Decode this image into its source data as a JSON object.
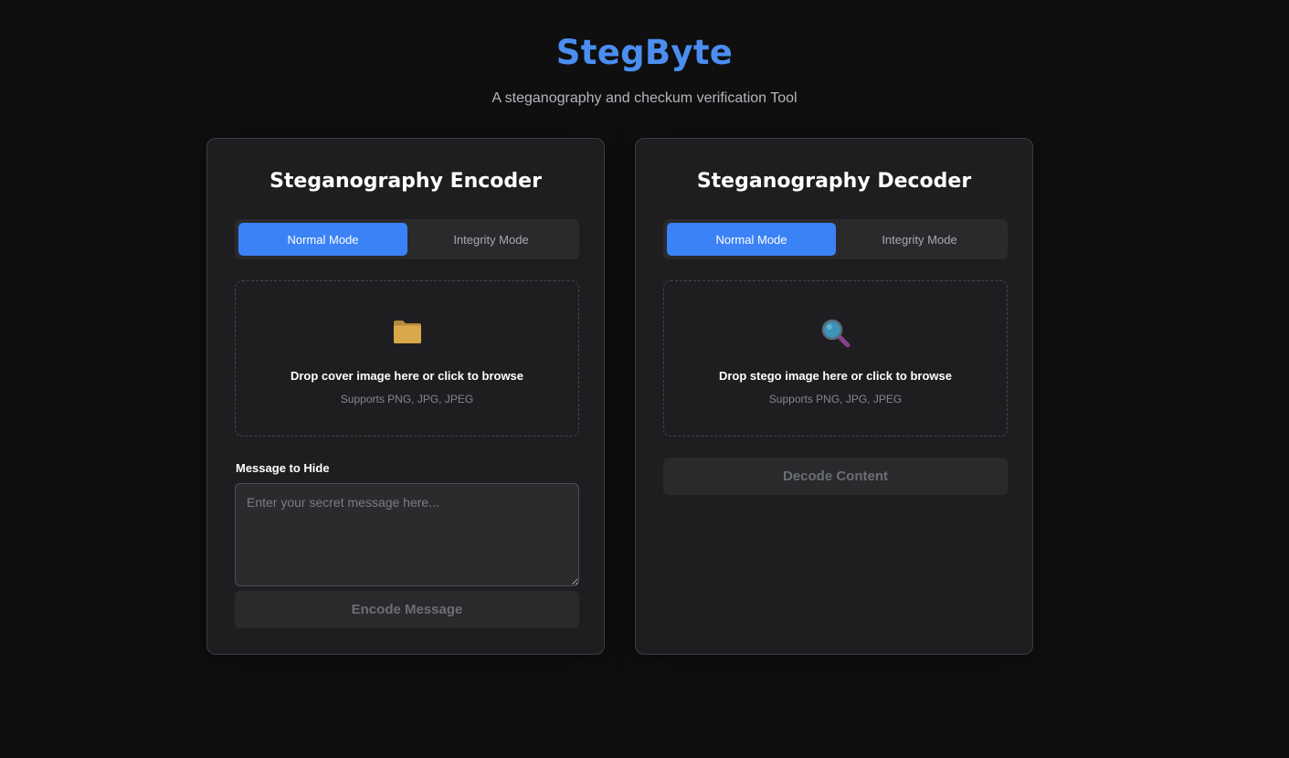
{
  "header": {
    "title": "StegByte",
    "subtitle": "A steganography and checkum verification Tool"
  },
  "encoder": {
    "title": "Steganography Encoder",
    "modes": {
      "normal": "Normal Mode",
      "integrity": "Integrity Mode",
      "active": "normal"
    },
    "dropzone": {
      "icon": "folder-icon",
      "text": "Drop cover image here or click to browse",
      "hint": "Supports PNG, JPG, JPEG"
    },
    "message_label": "Message to Hide",
    "message_value": "",
    "message_placeholder": "Enter your secret message here...",
    "action_label": "Encode Message"
  },
  "decoder": {
    "title": "Steganography Decoder",
    "modes": {
      "normal": "Normal Mode",
      "integrity": "Integrity Mode",
      "active": "normal"
    },
    "dropzone": {
      "icon": "magnifier-icon",
      "text": "Drop stego image here or click to browse",
      "hint": "Supports PNG, JPG, JPEG"
    },
    "action_label": "Decode Content"
  },
  "colors": {
    "background": "#0f0f10",
    "card": "#1e1e20",
    "accent": "#3b82f6",
    "title": "#4a8ef0"
  }
}
